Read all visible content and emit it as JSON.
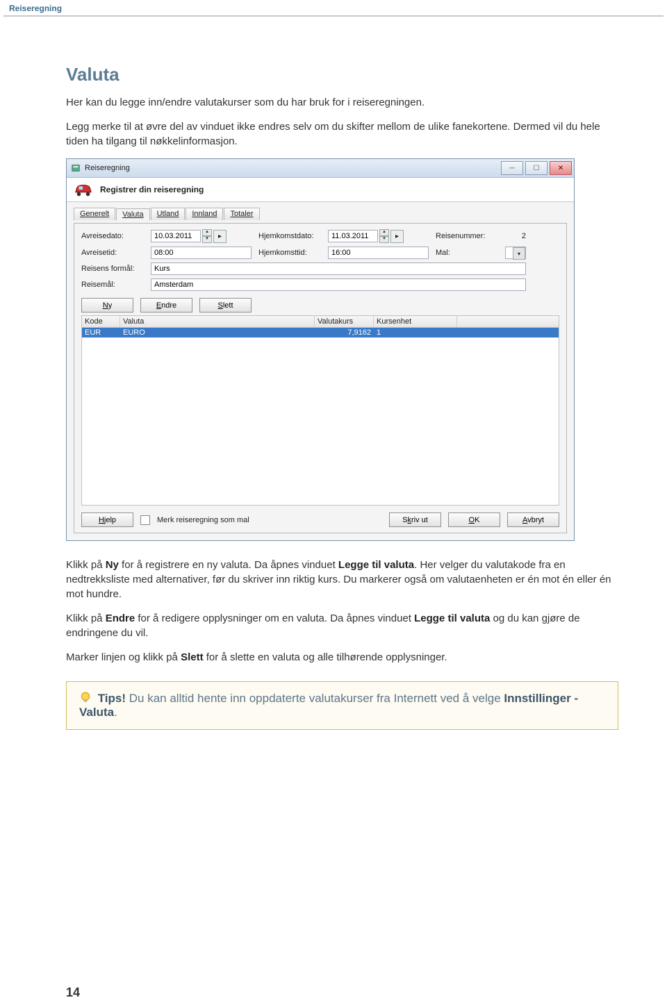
{
  "doc": {
    "header_title": "Reiseregning",
    "section_title": "Valuta",
    "para1": "Her kan du legge inn/endre valutakurser som du har bruk for i reiseregningen.",
    "para2": "Legg merke til at øvre del av vinduet ikke endres selv om du skifter mellom de ulike fanekortene. Dermed vil du hele tiden ha tilgang til nøkkelinformasjon.",
    "para3a": "Klikk på ",
    "para3b_ny": "Ny",
    "para3c": " for å registrere en ny valuta. Da åpnes vinduet ",
    "para3d_legge": "Legge til valuta",
    "para3e": ". Her velger du valutakode fra en nedtrekksliste med alternativer, før du skriver inn riktig kurs. Du markerer også om valutaenheten er én mot én eller én mot hundre.",
    "para4a": "Klikk på ",
    "para4b_endre": "Endre",
    "para4c": " for å redigere opplysninger om en valuta. Da åpnes vinduet ",
    "para4d_legge": "Legge til valuta",
    "para4e": " og du kan gjøre de endringene du vil.",
    "para5a": "Marker linjen og klikk på ",
    "para5b_slett": "Slett",
    "para5c": " for å slette en valuta og alle tilhørende opplysninger.",
    "tip_label": "Tips!",
    "tip_text": " Du kan alltid hente inn oppdaterte valutakurser fra Internett ved å velge ",
    "tip_link": "Innstillinger - Valuta",
    "tip_period": ".",
    "page_number": "14"
  },
  "win": {
    "title": "Reiseregning",
    "header": "Registrer din reiseregning",
    "tabs": [
      "Generelt",
      "Valuta",
      "Utland",
      "Innland",
      "Totaler"
    ],
    "active_tab": 1,
    "fields": {
      "avreisedato_lbl": "Avreisedato:",
      "avreisedato_val": "10.03.2011",
      "hjemkomstdato_lbl": "Hjemkomstdato:",
      "hjemkomstdato_val": "11.03.2011",
      "reisenummer_lbl": "Reisenummer:",
      "reisenummer_val": "2",
      "avreisetid_lbl": "Avreisetid:",
      "avreisetid_val": "08:00",
      "hjemkomsttid_lbl": "Hjemkomsttid:",
      "hjemkomsttid_val": "16:00",
      "mal_lbl": "Mal:",
      "mal_val": "",
      "formal_lbl": "Reisens formål:",
      "formal_val": "Kurs",
      "reisemal_lbl": "Reisemål:",
      "reisemal_val": "Amsterdam"
    },
    "buttons": {
      "ny": "Ny",
      "endre": "Endre",
      "slett": "Slett",
      "hjelp": "Hjelp",
      "skriv_ut": "Skriv ut",
      "ok": "OK",
      "avbryt": "Avbryt"
    },
    "checkbox_label": "Merk reiseregning som mal",
    "grid": {
      "headers": [
        "Kode",
        "Valuta",
        "Valutakurs",
        "Kursenhet"
      ],
      "rows": [
        {
          "kode": "EUR",
          "valuta": "EURO",
          "kurs": "7,9162",
          "enhet": "1"
        }
      ]
    }
  }
}
